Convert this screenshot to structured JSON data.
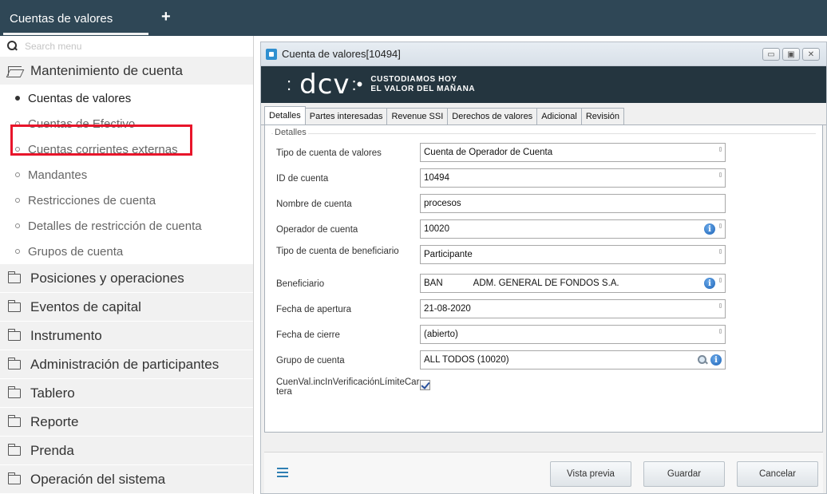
{
  "topbar": {
    "tab_label": "Cuentas de valores",
    "add_symbol": "+"
  },
  "sidebar": {
    "search_placeholder": "Search menu",
    "sections": [
      {
        "label": "Mantenimiento de cuenta",
        "open": true,
        "items": [
          {
            "label": "Cuentas de valores",
            "active": true
          },
          {
            "label": "Cuentas de Efectivo"
          },
          {
            "label": "Cuentas corrientes externas"
          },
          {
            "label": "Mandantes"
          },
          {
            "label": "Restricciones de cuenta"
          },
          {
            "label": "Detalles de restricción de cuenta"
          },
          {
            "label": "Grupos de cuenta"
          }
        ]
      },
      {
        "label": "Posiciones y operaciones"
      },
      {
        "label": "Eventos de capital"
      },
      {
        "label": "Instrumento"
      },
      {
        "label": "Administración de participantes"
      },
      {
        "label": "Tablero"
      },
      {
        "label": "Reporte"
      },
      {
        "label": "Prenda"
      },
      {
        "label": "Operación del sistema"
      }
    ],
    "highlight_color": "#e8152a"
  },
  "window": {
    "title": "Cuenta de valores[10494]",
    "controls": [
      "minimize-icon",
      "restore-icon",
      "close-icon"
    ]
  },
  "banner": {
    "logo_text": "dcv",
    "tagline_line1": "CUSTODIAMOS HOY",
    "tagline_line2": "EL VALOR DEL MAÑANA",
    "background": "#24353f"
  },
  "tabs": [
    "Detalles",
    "Partes interesadas",
    "Revenue SSI",
    "Derechos de valores",
    "Adicional",
    "Revisión"
  ],
  "form": {
    "group_label": "Detalles",
    "fields": {
      "tipo_cuenta": {
        "label": "Tipo de cuenta de valores",
        "value": "Cuenta de Operador de Cuenta"
      },
      "id_cuenta": {
        "label": "ID de cuenta",
        "value": "10494"
      },
      "nombre_cuenta": {
        "label": "Nombre de cuenta",
        "value": "procesos"
      },
      "operador_cuenta": {
        "label": "Operador de cuenta",
        "value": "10020"
      },
      "tipo_beneficiario": {
        "label": "Tipo de cuenta de beneficiario",
        "value": "Participante"
      },
      "beneficiario": {
        "label": "Beneficiario",
        "value_code": "BAN",
        "value_name": "ADM. GENERAL DE FONDOS S.A."
      },
      "fecha_apertura": {
        "label": "Fecha de apertura",
        "value": "21-08-2020"
      },
      "fecha_cierre": {
        "label": "Fecha de cierre",
        "value": "(abierto)"
      },
      "grupo_cuenta": {
        "label": "Grupo de cuenta",
        "value": "ALL TODOS (10020)"
      },
      "verificacion": {
        "label": "CuenVal.incInVerificaciónLímiteCartera",
        "checked": true
      }
    }
  },
  "footer": {
    "preview_label": "Vista previa",
    "save_label": "Guardar",
    "cancel_label": "Cancelar"
  }
}
